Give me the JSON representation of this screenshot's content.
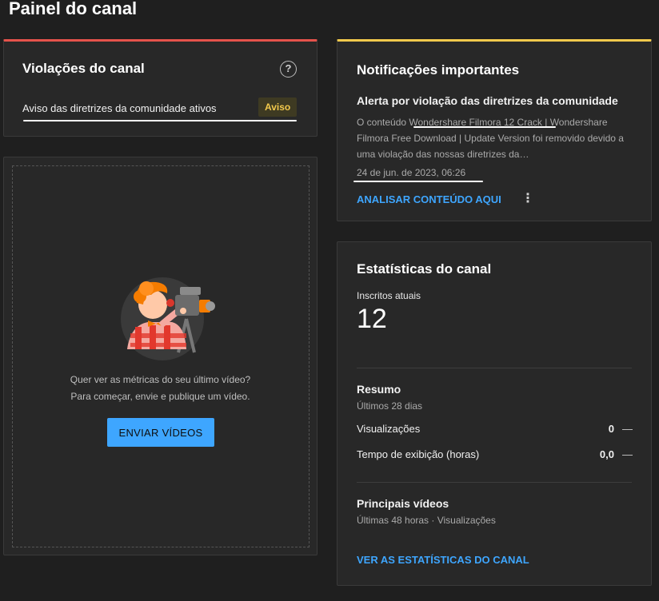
{
  "page": {
    "title": "Painel do canal"
  },
  "violations": {
    "title": "Violações do canal",
    "help_icon": "?",
    "warning_text": "Aviso das diretrizes da comunidade ativos",
    "badge": "Aviso",
    "accent": "#e5534b",
    "badge_color": "#f2c94c"
  },
  "upload": {
    "line1": "Quer ver as métricas do seu último vídeo?",
    "line2": "Para começar, envie e publique um vídeo.",
    "button_label": "ENVIAR VÍDEOS",
    "button_color": "#3ea6ff"
  },
  "notifications": {
    "title": "Notificações importantes",
    "accent": "#f2c94c",
    "alert_title": "Alerta por violação das diretrizes da comunidade",
    "body_prefix": "O conteúdo ",
    "body_highlight": "Wondershare Filmora 12 Crack",
    "body_suffix": " | Wondershare Filmora Free Download | Update Version foi removido devido a uma violação das nossas diretrizes da…",
    "date": "24 de jun. de 2023, 06:26",
    "action_label": "ANALISAR CONTEÚDO AQUI",
    "more_icon": "⋮"
  },
  "stats": {
    "title": "Estatísticas do canal",
    "subscribers_label": "Inscritos atuais",
    "subscribers_value": "12",
    "summary": {
      "title": "Resumo",
      "period": "Últimos 28 dias",
      "rows": [
        {
          "label": "Visualizações",
          "value": "0",
          "trend": "—"
        },
        {
          "label": "Tempo de exibição (horas)",
          "value": "0,0",
          "trend": "—"
        }
      ]
    },
    "top_videos": {
      "title": "Principais vídeos",
      "period": "Últimas 48 horas · Visualizações"
    },
    "action_label": "VER AS ESTATÍSTICAS DO CANAL"
  }
}
